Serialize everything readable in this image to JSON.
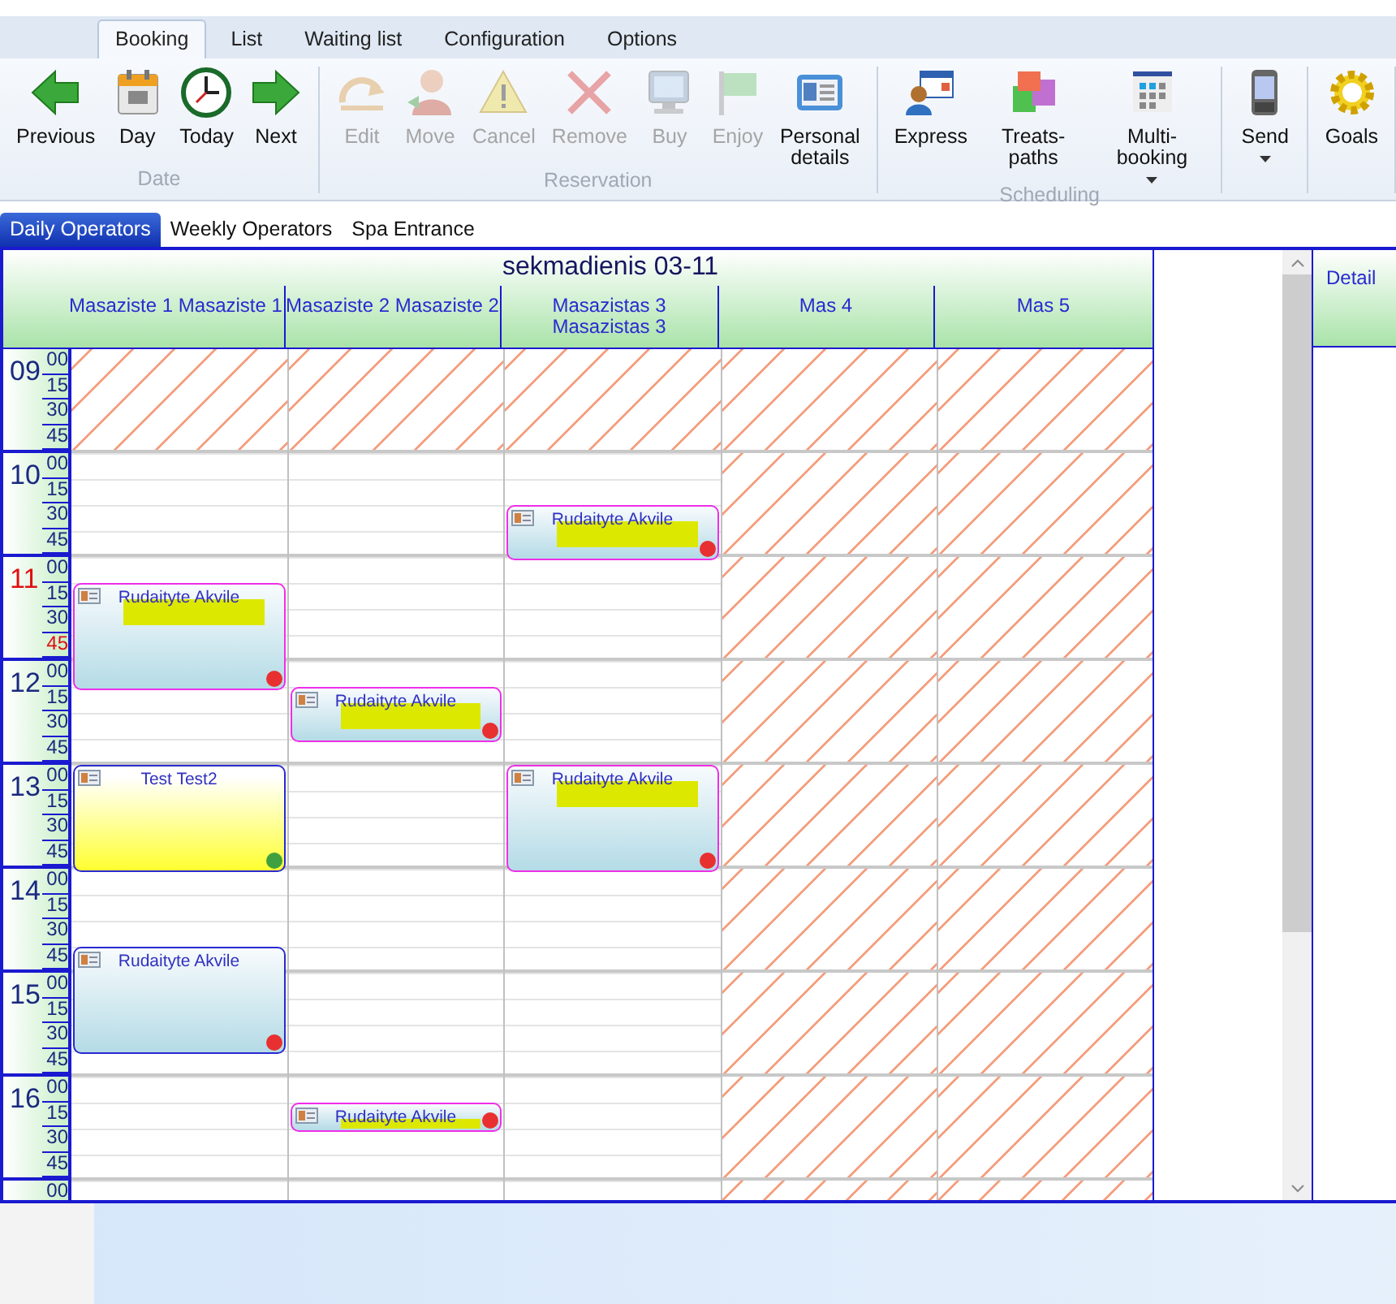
{
  "tabs": [
    {
      "label": "Booking",
      "selected": true
    },
    {
      "label": "List",
      "selected": false
    },
    {
      "label": "Waiting list",
      "selected": false
    },
    {
      "label": "Configuration",
      "selected": false
    },
    {
      "label": "Options",
      "selected": false
    }
  ],
  "ribbon": {
    "groups": [
      {
        "label": "Date",
        "buttons": [
          {
            "label": "Previous",
            "disabled": false,
            "dropdown": false
          },
          {
            "label": "Day",
            "disabled": false,
            "dropdown": false
          },
          {
            "label": "Today",
            "disabled": false,
            "dropdown": false
          },
          {
            "label": "Next",
            "disabled": false,
            "dropdown": false
          }
        ]
      },
      {
        "label": "Reservation",
        "buttons": [
          {
            "label": "Edit",
            "disabled": true,
            "dropdown": false
          },
          {
            "label": "Move",
            "disabled": true,
            "dropdown": false
          },
          {
            "label": "Cancel",
            "disabled": true,
            "dropdown": false
          },
          {
            "label": "Remove",
            "disabled": true,
            "dropdown": false
          },
          {
            "label": "Buy",
            "disabled": true,
            "dropdown": false
          },
          {
            "label": "Enjoy",
            "disabled": true,
            "dropdown": false
          },
          {
            "label": "Personal\ndetails",
            "disabled": false,
            "dropdown": false
          }
        ]
      },
      {
        "label": "Scheduling",
        "buttons": [
          {
            "label": "Express",
            "disabled": false,
            "dropdown": false
          },
          {
            "label": "Treats-paths",
            "disabled": false,
            "dropdown": false
          },
          {
            "label": "Multi-booking",
            "disabled": false,
            "dropdown": true
          }
        ]
      },
      {
        "buttons": [
          {
            "label": "Send",
            "disabled": false,
            "dropdown": true
          }
        ]
      },
      {
        "buttons": [
          {
            "label": "Goals",
            "disabled": false,
            "dropdown": false
          }
        ]
      }
    ]
  },
  "view_tabs": [
    {
      "label": "Daily Operators",
      "selected": true
    },
    {
      "label": "Weekly Operators",
      "selected": false
    },
    {
      "label": "Spa Entrance",
      "selected": false
    }
  ],
  "calendar": {
    "date_title": "sekmadienis 03-11",
    "columns": [
      {
        "name": "Masaziste 1 Masaziste 1",
        "available": true,
        "slots": [
          {
            "kind": "free"
          },
          {
            "kind": "free"
          },
          {
            "kind": "free"
          },
          {
            "kind": "free"
          },
          {
            "kind": "free"
          },
          {
            "kind": "free"
          },
          {
            "kind": "free"
          },
          {
            "kind": "free"
          },
          {
            "kind": "free"
          },
          {
            "kind": "reserved",
            "name": "Rudaityte Akvile",
            "color": "#e83030",
            "redacted": true
          },
          {
            "kind": "continued"
          },
          {
            "kind": "continued"
          },
          {
            "kind": "continued"
          },
          {
            "kind": "free"
          },
          {
            "kind": "free"
          },
          {
            "kind": "free"
          },
          {
            "kind": "test",
            "name": "Test Test2",
            "color": "#40a040",
            "redacted": false
          },
          {
            "kind": "continued"
          },
          {
            "kind": "continued"
          },
          {
            "kind": "continued"
          },
          {
            "kind": "free"
          },
          {
            "kind": "free"
          },
          {
            "kind": "free"
          },
          {
            "kind": "confirmed",
            "name": "Rudaityte Akvile",
            "color": "#e83030",
            "redacted": false
          },
          {
            "kind": "continued"
          },
          {
            "kind": "continued"
          },
          {
            "kind": "continued"
          }
        ]
      },
      {
        "name": "Masaziste 2 Masaziste 2",
        "available": true,
        "slots": [
          {
            "kind": "free"
          },
          {
            "kind": "free"
          },
          {
            "kind": "free"
          },
          {
            "kind": "free"
          },
          {
            "kind": "free"
          },
          {
            "kind": "free"
          },
          {
            "kind": "free"
          },
          {
            "kind": "free"
          },
          {
            "kind": "free"
          },
          {
            "kind": "free"
          },
          {
            "kind": "free"
          },
          {
            "kind": "free"
          },
          {
            "kind": "free"
          },
          {
            "kind": "reserved",
            "name": "Rudaityte Akvile",
            "color": "#e83030",
            "redacted": true
          },
          {
            "kind": "continued"
          },
          {
            "kind": "free"
          },
          {
            "kind": "free"
          },
          {
            "kind": "free"
          },
          {
            "kind": "free"
          },
          {
            "kind": "free"
          },
          {
            "kind": "free"
          },
          {
            "kind": "free"
          },
          {
            "kind": "free"
          },
          {
            "kind": "free"
          },
          {
            "kind": "free"
          },
          {
            "kind": "free"
          },
          {
            "kind": "free"
          },
          {
            "kind": "free"
          },
          {
            "kind": "free"
          },
          {
            "kind": "reserved",
            "name": "Rudaityte Akvile",
            "color": "#e83030",
            "redacted": true
          }
        ]
      },
      {
        "name": "Masazistas 3 Masazistas 3",
        "available": true,
        "slots": [
          {
            "kind": "free"
          },
          {
            "kind": "free"
          },
          {
            "kind": "free"
          },
          {
            "kind": "free"
          },
          {
            "kind": "free"
          },
          {
            "kind": "free"
          },
          {
            "kind": "reserved",
            "name": "Rudaityte Akvile",
            "color": "#e83030",
            "redacted": true
          },
          {
            "kind": "continued"
          },
          {
            "kind": "free"
          },
          {
            "kind": "free"
          },
          {
            "kind": "free"
          },
          {
            "kind": "free"
          },
          {
            "kind": "free"
          },
          {
            "kind": "free"
          },
          {
            "kind": "free"
          },
          {
            "kind": "free"
          },
          {
            "kind": "reserved",
            "name": "Rudaityte Akvile",
            "color": "#e83030",
            "redacted": true
          },
          {
            "kind": "continued"
          },
          {
            "kind": "continued"
          },
          {
            "kind": "continued"
          }
        ]
      },
      {
        "name": "Mas 4",
        "available": false
      },
      {
        "name": "Mas 5",
        "available": false
      }
    ],
    "hours": [
      {
        "label": "09",
        "closed": true,
        "current": false,
        "minutes": [
          {
            "label": "00",
            "current": false
          },
          {
            "label": "15",
            "current": false
          },
          {
            "label": "30",
            "current": false
          },
          {
            "label": "45",
            "current": false
          }
        ]
      },
      {
        "label": "10",
        "closed": false,
        "current": false,
        "minutes": [
          {
            "label": "00",
            "current": false
          },
          {
            "label": "15",
            "current": false
          },
          {
            "label": "30",
            "current": false
          },
          {
            "label": "45",
            "current": false
          }
        ]
      },
      {
        "label": "11",
        "closed": false,
        "current": true,
        "minutes": [
          {
            "label": "00",
            "current": false
          },
          {
            "label": "15",
            "current": false
          },
          {
            "label": "30",
            "current": false
          },
          {
            "label": "45",
            "current": true
          }
        ]
      },
      {
        "label": "12",
        "closed": false,
        "current": false,
        "minutes": [
          {
            "label": "00",
            "current": false
          },
          {
            "label": "15",
            "current": false
          },
          {
            "label": "30",
            "current": false
          },
          {
            "label": "45",
            "current": false
          }
        ]
      },
      {
        "label": "13",
        "closed": false,
        "current": false,
        "minutes": [
          {
            "label": "00",
            "current": false
          },
          {
            "label": "15",
            "current": false
          },
          {
            "label": "30",
            "current": false
          },
          {
            "label": "45",
            "current": false
          }
        ]
      },
      {
        "label": "14",
        "closed": false,
        "current": false,
        "minutes": [
          {
            "label": "00",
            "current": false
          },
          {
            "label": "15",
            "current": false
          },
          {
            "label": "30",
            "current": false
          },
          {
            "label": "45",
            "current": false
          }
        ]
      },
      {
        "label": "15",
        "closed": false,
        "current": false,
        "minutes": [
          {
            "label": "00",
            "current": false
          },
          {
            "label": "15",
            "current": false
          },
          {
            "label": "30",
            "current": false
          },
          {
            "label": "45",
            "current": false
          }
        ]
      },
      {
        "label": "16",
        "closed": false,
        "current": false,
        "minutes": [
          {
            "label": "00",
            "current": false
          },
          {
            "label": "15",
            "current": false
          },
          {
            "label": "30",
            "current": false
          },
          {
            "label": "45",
            "current": false
          }
        ]
      },
      {
        "closed": false,
        "minutes": [
          {
            "label": "00",
            "current": false
          }
        ]
      }
    ]
  },
  "detail_panel": {
    "title": "Detail"
  }
}
